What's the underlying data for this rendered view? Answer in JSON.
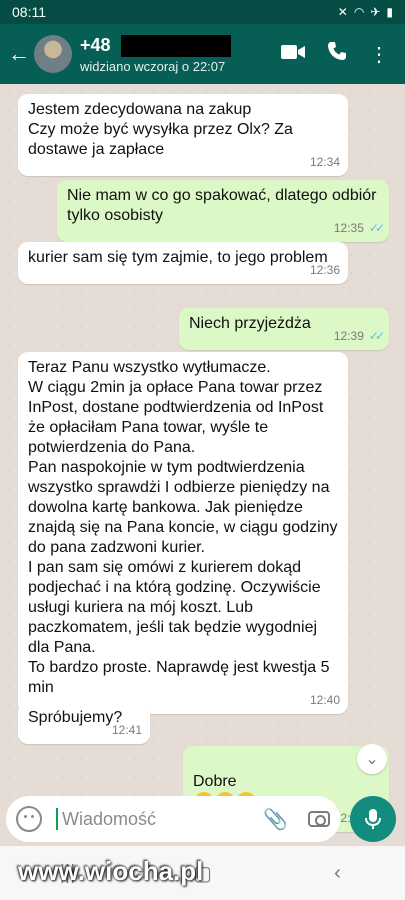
{
  "statusbar": {
    "time": "08:11"
  },
  "header": {
    "contact_number": "+48",
    "last_seen": "widziano wczoraj o 22:07"
  },
  "messages": [
    {
      "text": "Jestem zdecydowana na zakup\nCzy może być wysyłka przez Olx? Za dostawe ja zapłace",
      "time": "12:34"
    },
    {
      "text": "Nie mam w co go spakować, dlatego odbiór tylko osobisty",
      "time": "12:35"
    },
    {
      "text": "kurier sam się tym zajmie, to jego problem",
      "time": "12:36"
    },
    {
      "text": "Niech przyjeżdża",
      "time": "12:39"
    },
    {
      "text": "Teraz Panu wszystko wytłumacze.\nW ciągu 2min ja opłace Pana towar przez InPost, dostane podtwierdzenia od InPost że opłaciłam Pana towar, wyśle te potwierdzenia do Pana.\nPan naspokojnie w tym podtwierdzenia wszystko sprawdżi I odbierze pieniędzy na dowolna kartę bankowa. Jak pieniędze znajdą się na Pana koncie, w ciągu godziny do pana zadzwoni kurier.\nI pan sam się omówi z kurierem dokąd podjechać i na którą godzinę. Oczywiście usługi kuriera na mój koszt. Lub paczkomatem, jeśli tak będzie wygodniej dla Pana.\nTo bardzo proste. Naprawdę jest kwestja 5 min",
      "time": "12:40"
    },
    {
      "text": "Spróbujemy?",
      "time": "12:41"
    },
    {
      "text": "Dobre",
      "time": "12:44"
    }
  ],
  "composer": {
    "placeholder": "Wiadomość"
  },
  "watermark": "www.wiocha.pl",
  "colors": {
    "header": "#075e54",
    "outgoing": "#dcf8c6",
    "incoming": "#ffffff",
    "accent": "#128c7e"
  }
}
